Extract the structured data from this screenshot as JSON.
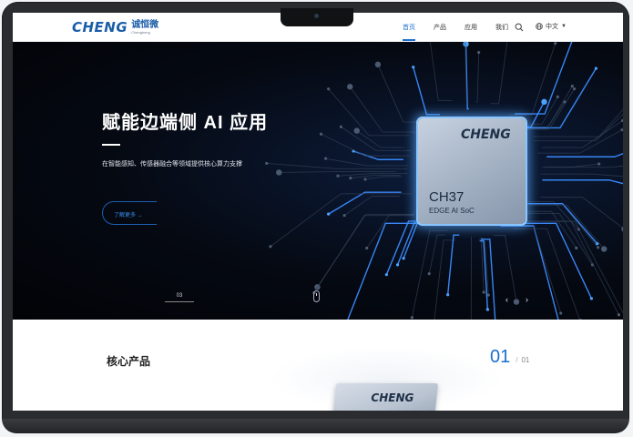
{
  "logo": {
    "mark": "CHENG",
    "cn": "诚恒微",
    "en_small": "Chengheng"
  },
  "nav": {
    "items": [
      {
        "label": "首页",
        "active": true
      },
      {
        "label": "产品",
        "active": false
      },
      {
        "label": "应用",
        "active": false
      },
      {
        "label": "我们",
        "active": false
      }
    ],
    "search_icon": "search-icon",
    "language": "中文"
  },
  "hero": {
    "title": "赋能边端侧 AI 应用",
    "subtitle": "在智能感知、传感器融合等领域提供核心算力支撑",
    "button_label": "了解更多 →",
    "slide_number": "03",
    "chip": {
      "logo": "CHENG",
      "model": "CH37",
      "line": "EDGE AI SoC"
    }
  },
  "section": {
    "title": "核心产品",
    "counter_current": "01",
    "counter_separator": "/",
    "counter_total": "01",
    "chip_logo": "CHENG"
  },
  "colors": {
    "brand": "#1a5ea8",
    "accent": "#1a6fd1",
    "glow": "#58aaff"
  }
}
